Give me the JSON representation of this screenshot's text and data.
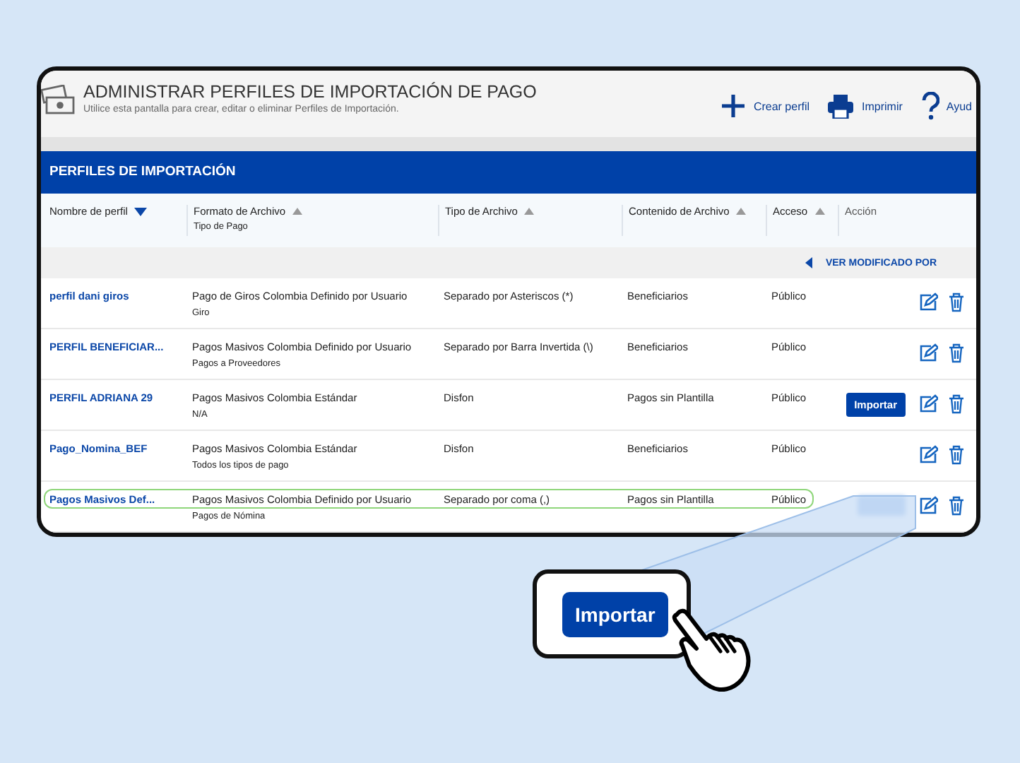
{
  "header": {
    "title": "ADMINISTRAR PERFILES DE IMPORTACIÓN DE PAGO",
    "subtitle": "Utilice esta pantalla para crear, editar o eliminar Perfiles de Importación.",
    "actions": [
      {
        "kind": "add",
        "label": "Crear perfil"
      },
      {
        "kind": "print",
        "label": "Imprimir"
      },
      {
        "kind": "help",
        "label": "Ayud"
      }
    ]
  },
  "panel": {
    "title": "PERFILES DE IMPORTACIÓN"
  },
  "table": {
    "columns": [
      {
        "label": "Nombre de perfil",
        "sortable": true,
        "sorted": true
      },
      {
        "label": "Formato de Archivo",
        "sublabel": "Tipo de Pago",
        "sortable": true,
        "sorted": false
      },
      {
        "label": "Tipo de Archivo",
        "sortable": true,
        "sorted": false
      },
      {
        "label": "Contenido de Archivo",
        "sortable": true,
        "sorted": false
      },
      {
        "label": "Acceso",
        "sortable": true,
        "sorted": false
      },
      {
        "label": "Acción",
        "sortable": false,
        "sorted": false
      }
    ],
    "toggle": "VER MODIFICADO POR",
    "rows": [
      {
        "name": "perfil dani giros",
        "format": "Pago de Giros Colombia Definido por Usuario",
        "payment_type": "Giro",
        "file_type": "Separado por Asteriscos (*)",
        "content": "Beneficiarios",
        "access": "Público",
        "import_button": false,
        "highlighted": false
      },
      {
        "name": "PERFIL BENEFICIAR...",
        "format": "Pagos Masivos Colombia Definido por Usuario",
        "payment_type": "Pagos a Proveedores",
        "file_type": "Separado por Barra Invertida (\\)",
        "content": "Beneficiarios",
        "access": "Público",
        "import_button": false,
        "highlighted": false
      },
      {
        "name": "PERFIL ADRIANA 29",
        "format": "Pagos Masivos Colombia Estándar",
        "payment_type": "N/A",
        "file_type": "Disfon",
        "content": "Pagos sin Plantilla",
        "access": "Público",
        "import_button": true,
        "import_label": "Importar",
        "highlighted": false
      },
      {
        "name": "Pago_Nomina_BEF",
        "format": "Pagos Masivos Colombia Estándar",
        "payment_type": "Todos los tipos de pago",
        "file_type": "Disfon",
        "content": "Beneficiarios",
        "access": "Público",
        "import_button": false,
        "highlighted": false
      },
      {
        "name": "Pagos Masivos Def...",
        "format": "Pagos Masivos Colombia Definido por Usuario",
        "payment_type": "Pagos de Nómina",
        "file_type": "Separado por coma (,)",
        "content": "Pagos sin Plantilla",
        "access": "Público",
        "import_button": true,
        "import_blurred": true,
        "highlighted": true
      }
    ]
  },
  "callout": {
    "button": "Importar"
  }
}
